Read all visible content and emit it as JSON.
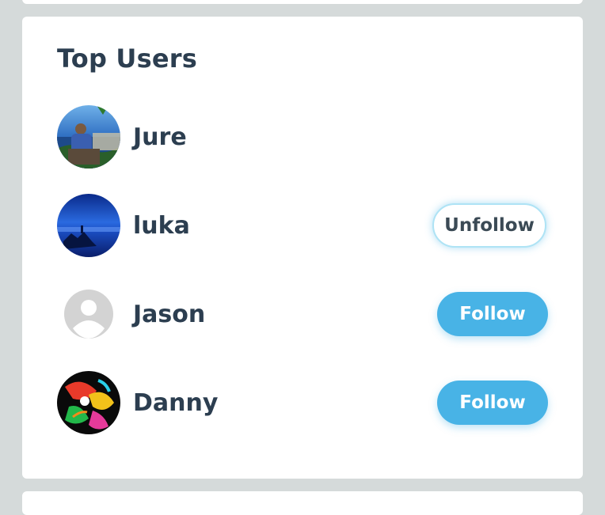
{
  "widget": {
    "title": "Top Users",
    "users": [
      {
        "name": "Jure",
        "action": null
      },
      {
        "name": "luka",
        "action": "Unfollow"
      },
      {
        "name": "Jason",
        "action": "Follow"
      },
      {
        "name": "Danny",
        "action": "Follow"
      }
    ]
  },
  "colors": {
    "page_bg": "#d5dada",
    "card_bg": "#ffffff",
    "text": "#2c3e50",
    "accent": "#48b3e6"
  }
}
